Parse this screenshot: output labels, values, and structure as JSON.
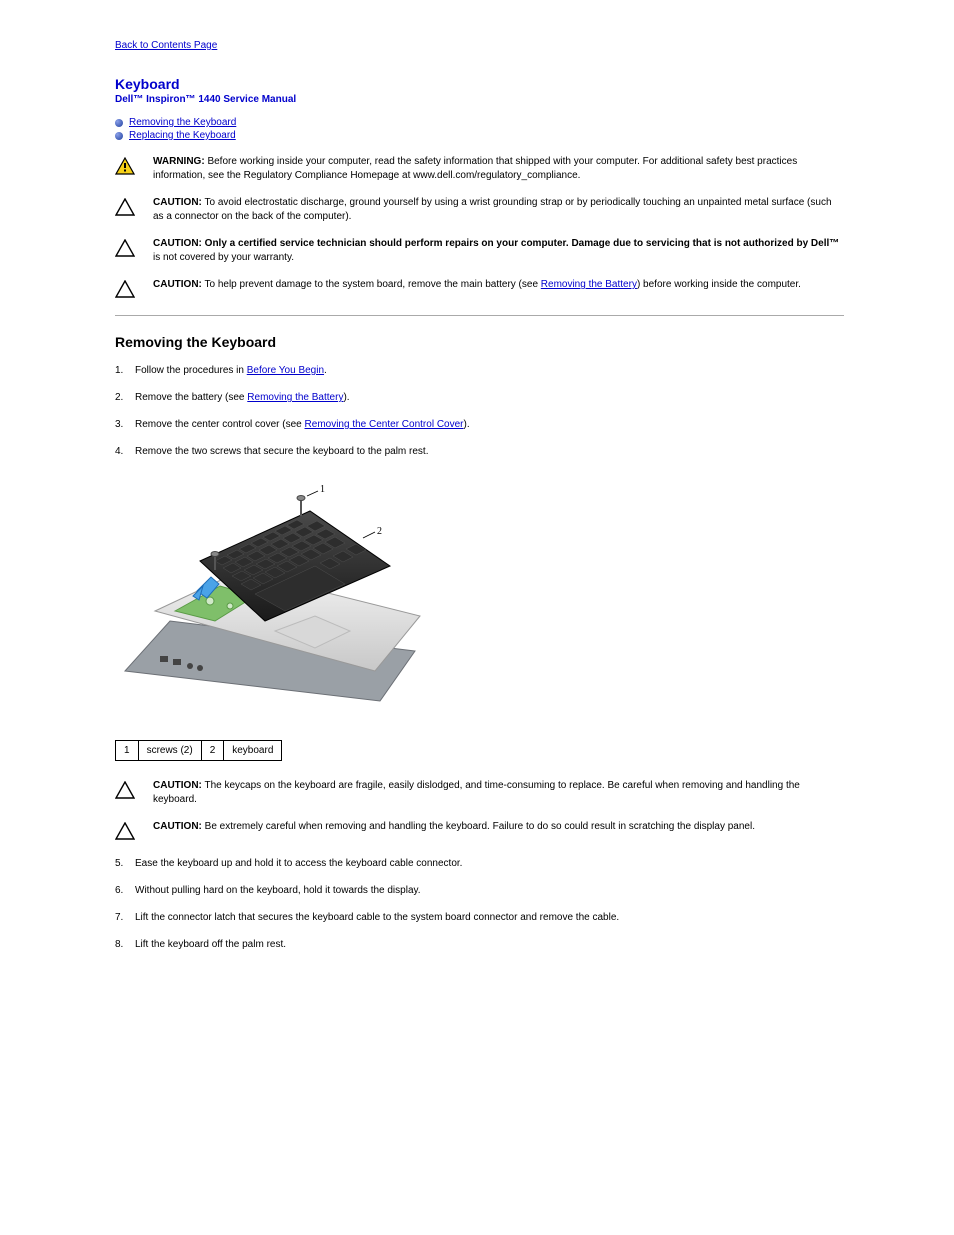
{
  "nav": {
    "back": "Back to Contents Page"
  },
  "titles": {
    "page": "Keyboard",
    "manual": "Dell™ Inspiron™ 1440 Service Manual"
  },
  "toc": {
    "remove": "Removing the Keyboard",
    "replace": "Replacing the Keyboard"
  },
  "callouts": {
    "warning": {
      "lead": "WARNING:",
      "text": " Before working inside your computer, read the safety information that shipped with your computer. For additional safety best practices information, see the Regulatory Compliance Homepage at www.dell.com/regulatory_compliance."
    },
    "esd": {
      "lead": "CAUTION:",
      "text": " To avoid electrostatic discharge, ground yourself by using a wrist grounding strap or by periodically touching an unpainted metal surface (such as a connector on the back of the computer)."
    },
    "tech": {
      "lead": "CAUTION:",
      "text_before": " ",
      "bold_text": "Only a certified service technician should perform repairs on your computer. Damage due to servicing that is not authorized by Dell™",
      "text_after": " is not covered by your warranty."
    },
    "battery": {
      "lead": "CAUTION:",
      "text_before": " To help prevent damage to the system board, remove the main battery (see ",
      "link": "Removing the Battery",
      "text_after": ") before working inside the computer."
    }
  },
  "section": {
    "title": "Removing the Keyboard"
  },
  "steps": {
    "s1": {
      "n": "1.",
      "before": "Follow the procedures in ",
      "link": "Before You Begin",
      "after": "."
    },
    "s2": {
      "n": "2.",
      "before": "Remove the battery (see ",
      "link": "Removing the Battery",
      "after": ")."
    },
    "s3": {
      "n": "3.",
      "before": "Remove the center control cover (see ",
      "link": "Removing the Center Control Cover",
      "after": ")."
    },
    "s4": {
      "n": "4.",
      "text": "Remove the two screws that secure the keyboard to the palm rest."
    },
    "s5": {
      "n": "5.",
      "text": "Ease the keyboard up and hold it to access the keyboard cable connector."
    },
    "s6": {
      "n": "6.",
      "text": "Without pulling hard on the keyboard, hold it towards the display."
    },
    "s7": {
      "n": "7.",
      "text": "Lift the connector latch that secures the keyboard cable to the system board connector and remove the cable."
    },
    "s8": {
      "n": "8.",
      "text": "Lift the keyboard off the palm rest."
    }
  },
  "parts_table": {
    "r1c1": "1",
    "r1c2": "screws (2)",
    "r2c1": "2",
    "r2c2": "keyboard"
  },
  "after_figure": {
    "fragile": {
      "lead": "CAUTION:",
      "text": " The keycaps on the keyboard are fragile, easily dislodged, and time-consuming to replace. Be careful when removing and handling the keyboard."
    },
    "extra": {
      "lead": "CAUTION:",
      "text": " Be extremely careful when removing and handling the keyboard. Failure to do so could result in scratching the display panel."
    }
  },
  "figure_labels": {
    "l1": "1",
    "l2": "2"
  }
}
